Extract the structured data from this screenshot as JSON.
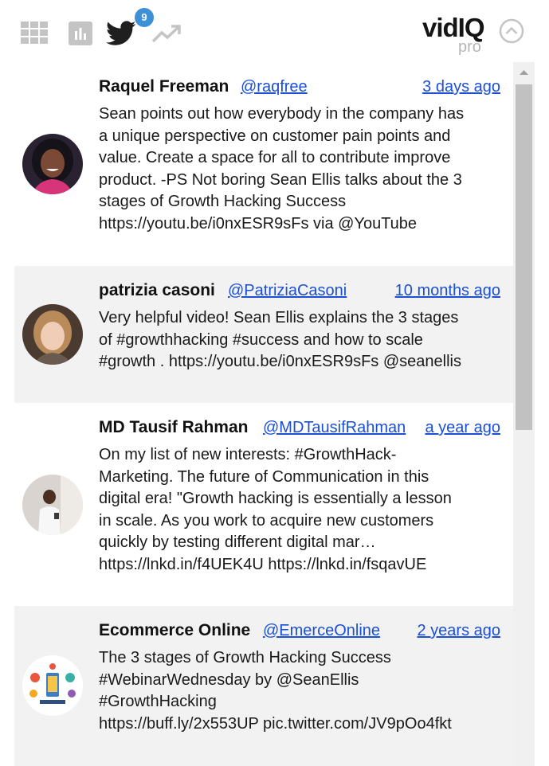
{
  "toolbar": {
    "icons": [
      "grid-icon",
      "bar-chart-icon",
      "twitter-icon",
      "trending-icon"
    ],
    "twitter_badge": "9"
  },
  "logo": {
    "brand": "vidIQ",
    "plan": "pro"
  },
  "colors": {
    "link": "#1a4fd6",
    "badge": "#3d8fd6",
    "panel": "#f2f2f2"
  },
  "tweets": [
    {
      "name": "Raquel Freeman",
      "handle": "@raqfree",
      "time": "3 days ago",
      "lines": [
        "Sean points out how everybody in the company has",
        "a unique perspective on customer pain points and",
        "value. Create a space for all to contribute improve",
        "product. -PS Not boring Sean Ellis talks about the 3",
        "stages of Growth Hacking Success",
        "https://youtu.be/i0nxESR9sFs  via @YouTube"
      ]
    },
    {
      "name": "patrizia casoni",
      "handle": "@PatriziaCasoni",
      "time": "10 months ago",
      "lines": [
        "Very helpful video! Sean Ellis explains the 3 stages",
        "of #growthhacking #success and how to scale",
        "#growth . https://youtu.be/i0nxESR9sFs  @seanellis"
      ]
    },
    {
      "name": "MD Tausif Rahman",
      "handle": "@MDTausifRahman",
      "time": "a year ago",
      "lines": [
        "On my list of new interests: #GrowthHack-",
        "Marketing. The future of Communication in this",
        "digital era! \"Growth hacking is essentially a lesson",
        "in scale. As you work to acquire new customers",
        "quickly by testing different digital mar…",
        "https://lnkd.in/f4UEK4U https://lnkd.in/fsqavUE"
      ]
    },
    {
      "name": "Ecommerce Online",
      "handle": "@EmerceOnline",
      "time": "2 years ago",
      "lines": [
        "The 3 stages of Growth Hacking Success",
        "#WebinarWednesday by @SeanEllis",
        "#GrowthHacking",
        "https://buff.ly/2x553UP pic.twitter.com/JV9pOo4fkt"
      ]
    }
  ]
}
